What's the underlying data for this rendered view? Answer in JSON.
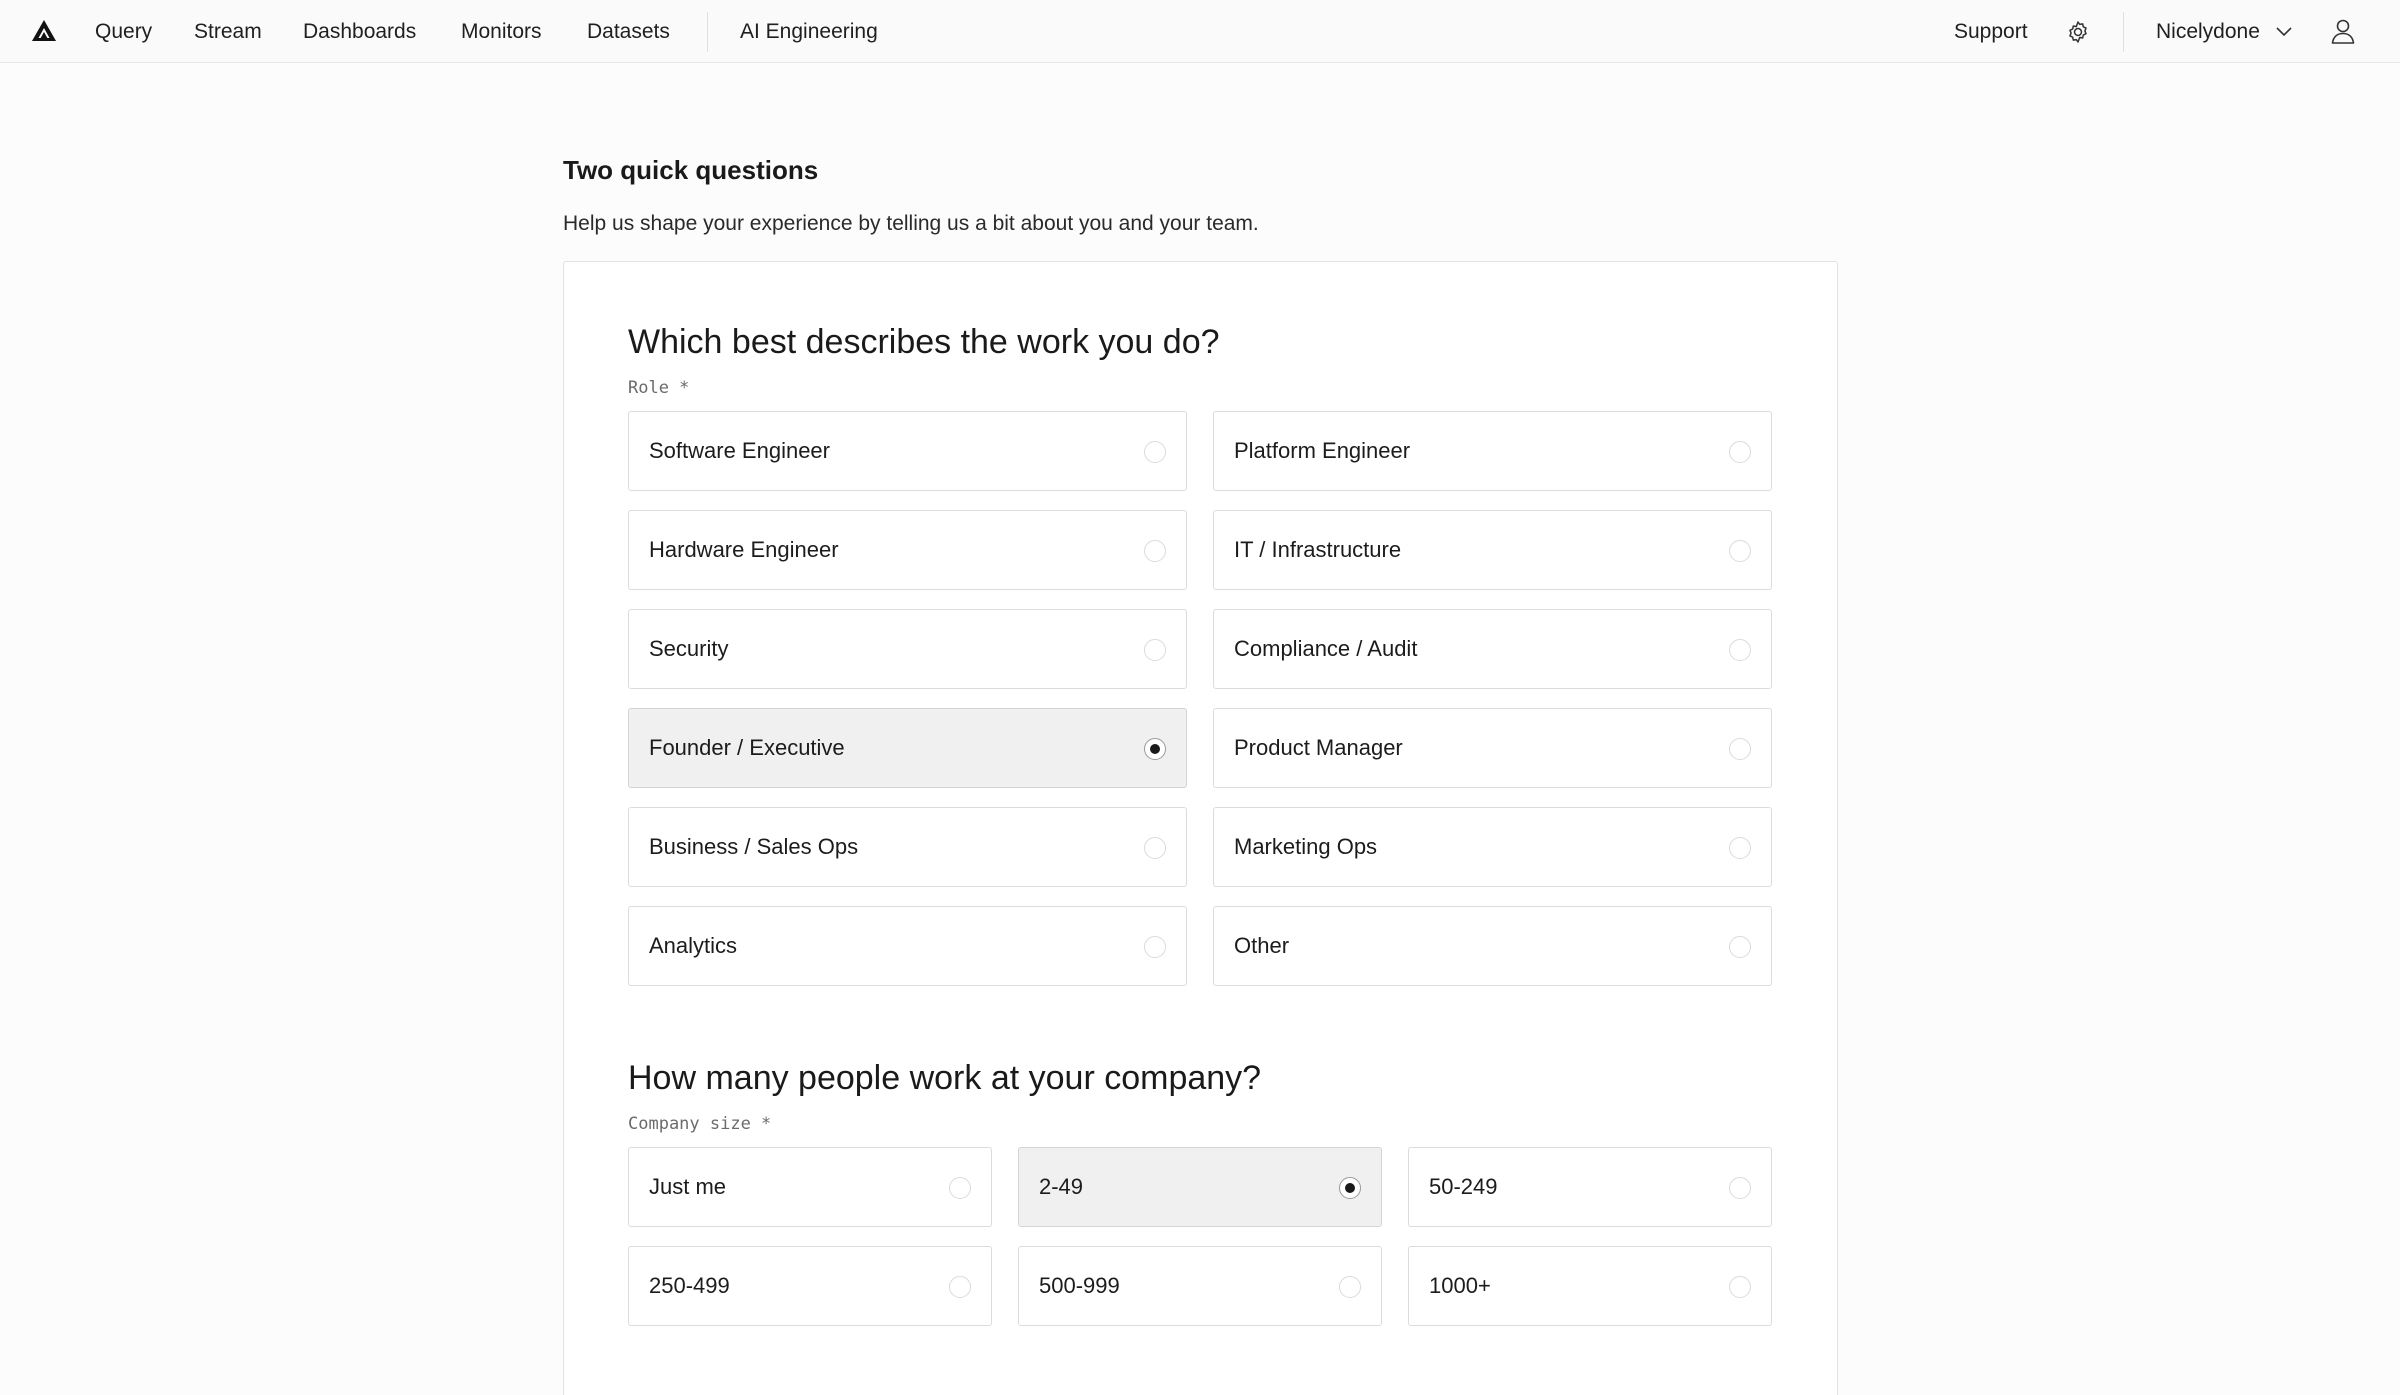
{
  "nav": {
    "items": [
      {
        "label": "Query"
      },
      {
        "label": "Stream"
      },
      {
        "label": "Dashboards"
      },
      {
        "label": "Monitors"
      },
      {
        "label": "Datasets"
      },
      {
        "label": "AI Engineering"
      }
    ],
    "support": "Support",
    "org": "Nicelydone"
  },
  "page": {
    "title": "Two quick questions",
    "subtitle": "Help us shape your experience by telling us a bit about you and your team."
  },
  "role": {
    "question": "Which best describes the work you do?",
    "label": "Role *",
    "selected": "Founder / Executive",
    "options": [
      "Software Engineer",
      "Platform Engineer",
      "Hardware Engineer",
      "IT / Infrastructure",
      "Security",
      "Compliance / Audit",
      "Founder / Executive",
      "Product Manager",
      "Business / Sales Ops",
      "Marketing Ops",
      "Analytics",
      "Other"
    ]
  },
  "company": {
    "question": "How many people work at your company?",
    "label": "Company size *",
    "selected": "2-49",
    "options": [
      "Just me",
      "2-49",
      "50-249",
      "250-499",
      "500-999",
      "1000+"
    ]
  }
}
